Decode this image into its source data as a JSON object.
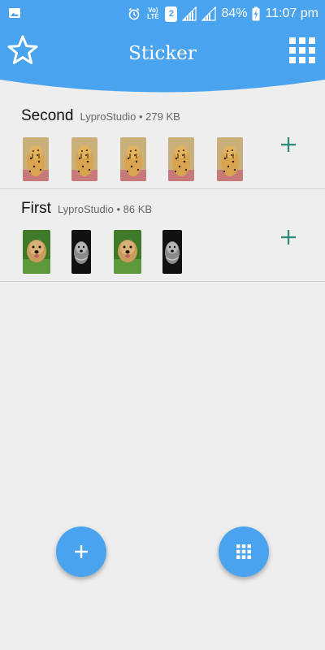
{
  "status_bar": {
    "gallery_icon": "image-icon",
    "network_label": "Vo) LTE",
    "sim_slot": "2",
    "battery": "84%",
    "time": "11:07 pm"
  },
  "app_bar": {
    "title": "Sticker",
    "left_icon": "star-outline-icon",
    "right_icon": "grid-icon",
    "color": "#4aa3ef"
  },
  "packs": [
    {
      "name": "Second",
      "publisher": "LyproStudio",
      "size": "279 KB",
      "separator": "•",
      "stickers": [
        "cheetah",
        "cheetah",
        "cheetah",
        "cheetah",
        "cheetah"
      ]
    },
    {
      "name": "First",
      "publisher": "LyproStudio",
      "size": "86 KB",
      "separator": "•",
      "stickers": [
        "dog-color",
        "dog-bw",
        "dog-color",
        "dog-bw"
      ]
    }
  ],
  "fabs": {
    "add_icon": "plus-icon",
    "grid_icon": "grid-icon"
  },
  "accent_add_color": "#2e8b7a"
}
